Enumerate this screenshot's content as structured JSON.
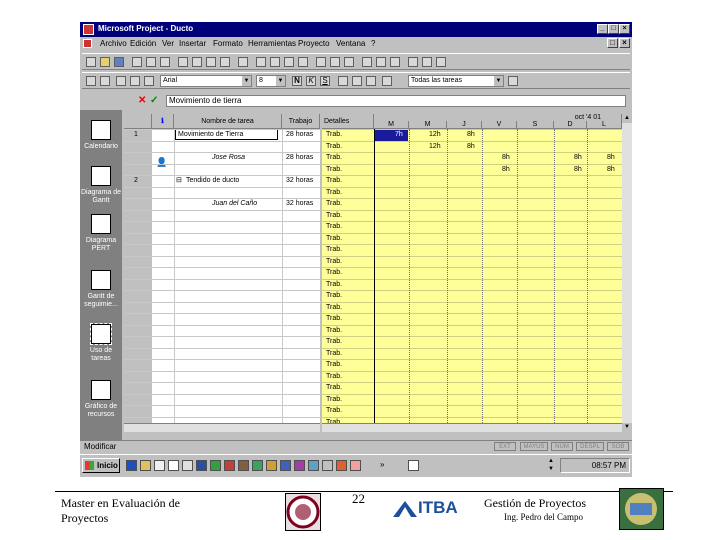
{
  "window": {
    "title": "Microsoft Project - Ducto",
    "menu": [
      "Archivo",
      "Edición",
      "Ver",
      "Insertar",
      "Formato",
      "Herramientas",
      "Proyecto",
      "Ventana",
      "?"
    ],
    "font_combo": "Arial",
    "size_combo": "8",
    "filter_combo": "Todas las tareas",
    "entry_value": "Movimiento de tierra"
  },
  "viewbar": [
    {
      "label": "Calendario",
      "icon": "calendar-icon"
    },
    {
      "label": "Diagrama de Gantt",
      "icon": "gantt-chart-icon"
    },
    {
      "label": "Diagrama PERT",
      "icon": "pert-diagram-icon"
    },
    {
      "label": "Gantt de seguimie...",
      "icon": "tracking-gantt-icon"
    },
    {
      "label": "Uso de tareas",
      "icon": "task-usage-icon"
    },
    {
      "label": "Gráfico de recursos",
      "icon": "resource-graph-icon"
    }
  ],
  "table": {
    "headers": [
      "Nombre de tarea",
      "Trabajo"
    ],
    "rows": [
      {
        "id": "1",
        "name": "Movimiento de Tierra",
        "work": "28 horas",
        "indent": 0
      },
      {
        "id": "",
        "name": "Jose Rosa",
        "work": "28 horas",
        "indent": 2
      },
      {
        "id": "2",
        "name": "Tendido de ducto",
        "work": "32 horas",
        "indent": 0
      },
      {
        "id": "",
        "name": "Juan del Caño",
        "work": "32 horas",
        "indent": 2
      }
    ]
  },
  "gantt": {
    "week_label": "oct '4 01",
    "detail_header": "Detalles",
    "days": [
      "M",
      "M",
      "J",
      "V",
      "S",
      "D",
      "L"
    ],
    "detail_label": "Trab.",
    "values": [
      [
        "",
        "7h",
        "12h",
        "8h",
        "",
        "",
        "",
        ""
      ],
      [
        "",
        "",
        "12h",
        "8h",
        "",
        "",
        "",
        ""
      ],
      [
        "",
        "",
        "",
        "",
        "8h",
        "",
        "8h",
        "8h"
      ],
      [
        "",
        "",
        "",
        "",
        "8h",
        "",
        "8h",
        "8h"
      ]
    ]
  },
  "status": {
    "mode": "Modificar",
    "indicators": [
      "EXT",
      "MAYÚS",
      "NUM",
      "DESPL",
      "SOB"
    ]
  },
  "taskbar": {
    "start": "Inicio",
    "time": "08:57 PM"
  },
  "footer": {
    "left": "Master en Evaluación de Proyectos",
    "page": "22",
    "logo_text": "ITBA",
    "right_title": "Gestión de Proyectos",
    "right_sub": "Ing. Pedro del Campo"
  }
}
